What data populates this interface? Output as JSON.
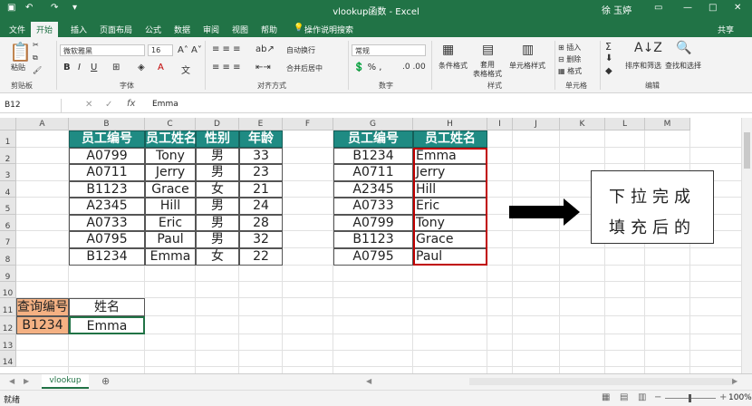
{
  "title": "vlookup函数 - Excel",
  "user": "徐 玉婷",
  "tabs": [
    "文件",
    "开始",
    "插入",
    "页面布局",
    "公式",
    "数据",
    "审阅",
    "视图",
    "帮助"
  ],
  "tell_me": "操作说明搜索",
  "share": "共享",
  "ribbon": {
    "paste": "粘贴",
    "clipboard": "剪贴板",
    "font_name": "微软雅黑",
    "font_size": "16",
    "font": "字体",
    "wrap": "自动换行",
    "merge": "合并后居中",
    "align": "对齐方式",
    "num_format": "常规",
    "number": "数字",
    "cond": "条件格式",
    "table": "套用\n表格格式",
    "cellstyle": "单元格样式",
    "styles": "样式",
    "insert": "插入",
    "delete": "删除",
    "format": "格式",
    "cells": "单元格",
    "sortfilter": "排序和筛选",
    "findsel": "查找和选择",
    "editing": "编辑"
  },
  "formula_bar": {
    "name_box": "B12",
    "value": "Emma"
  },
  "columns": [
    "A",
    "B",
    "C",
    "D",
    "E",
    "F",
    "G",
    "H",
    "I",
    "J",
    "K",
    "L",
    "M"
  ],
  "rows": [
    "1",
    "2",
    "3",
    "4",
    "5",
    "6",
    "7",
    "8",
    "9",
    "10",
    "11",
    "12",
    "13",
    "14"
  ],
  "table1": {
    "headers": [
      "员工编号",
      "员工姓名",
      "性别",
      "年龄"
    ],
    "rows": [
      [
        "A0799",
        "Tony",
        "男",
        "33"
      ],
      [
        "A0711",
        "Jerry",
        "男",
        "23"
      ],
      [
        "B1123",
        "Grace",
        "女",
        "21"
      ],
      [
        "A2345",
        "Hill",
        "男",
        "24"
      ],
      [
        "A0733",
        "Eric",
        "男",
        "28"
      ],
      [
        "A0795",
        "Paul",
        "男",
        "32"
      ],
      [
        "B1234",
        "Emma",
        "女",
        "22"
      ]
    ]
  },
  "table2": {
    "headers": [
      "员工编号",
      "员工姓名"
    ],
    "rows": [
      [
        "B1234",
        "Emma"
      ],
      [
        "A0711",
        "Jerry"
      ],
      [
        "A2345",
        "Hill"
      ],
      [
        "A0733",
        "Eric"
      ],
      [
        "A0799",
        "Tony"
      ],
      [
        "B1123",
        "Grace"
      ],
      [
        "A0795",
        "Paul"
      ]
    ]
  },
  "lookup": {
    "label1": "查询编号",
    "label2": "姓名",
    "id": "B1234",
    "name": "Emma"
  },
  "callout": [
    "下拉完成",
    "填充后的"
  ],
  "sheet_tab": "vlookup",
  "status": "就绪",
  "zoom": "100%",
  "colors": {
    "excel_green": "#217346",
    "header_teal": "#1f8b83",
    "lookup_orange": "#f4b183",
    "red_border": "#c00000"
  }
}
